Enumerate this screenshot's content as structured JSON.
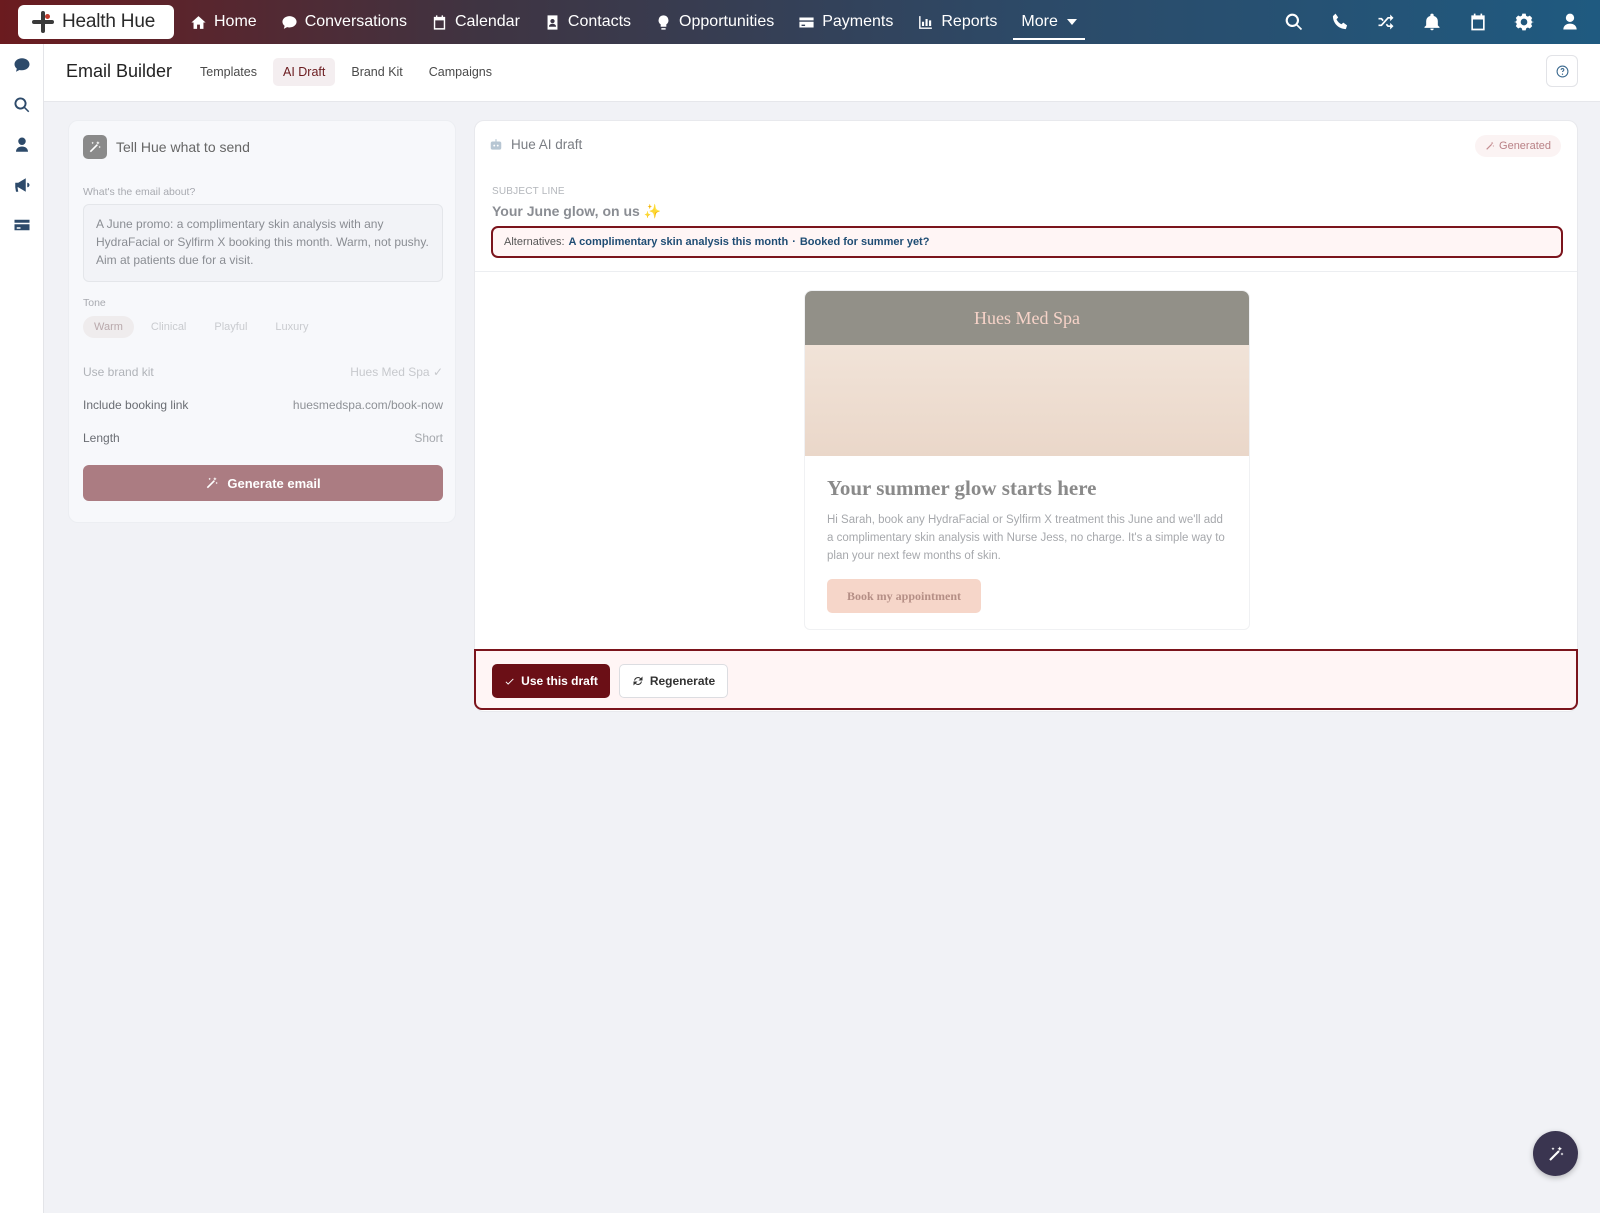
{
  "brand": {
    "name": "Health Hue",
    "logo_icon": "health-hue-logo"
  },
  "nav": {
    "items": [
      {
        "label": "Home",
        "icon": "home-icon"
      },
      {
        "label": "Conversations",
        "icon": "chat-icon"
      },
      {
        "label": "Calendar",
        "icon": "calendar-icon"
      },
      {
        "label": "Contacts",
        "icon": "contact-card-icon"
      },
      {
        "label": "Opportunities",
        "icon": "lightbulb-icon"
      },
      {
        "label": "Payments",
        "icon": "credit-card-icon"
      },
      {
        "label": "Reports",
        "icon": "bar-chart-icon"
      },
      {
        "label": "More",
        "icon": "chevron-down-icon"
      }
    ],
    "right_icons": [
      "search-icon",
      "phone-icon",
      "shuffle-icon",
      "bell-icon",
      "calendar-icon",
      "gear-icon",
      "user-icon"
    ]
  },
  "rail": {
    "icons": [
      "chat-icon",
      "search-icon",
      "user-icon",
      "megaphone-icon",
      "credit-card-icon"
    ]
  },
  "subheader": {
    "title": "Email Builder",
    "tabs": [
      "Templates",
      "AI Draft",
      "Brand Kit",
      "Campaigns"
    ],
    "active_tab": "AI Draft"
  },
  "left_panel": {
    "title": "Tell Hue what to send",
    "prompt_label": "What's the email about?",
    "prompt_text": "A June promo: a complimentary skin analysis with any HydraFacial or Sylfirm X booking this month. Warm, not pushy. Aim at patients due for a visit.",
    "tone_label": "Tone",
    "tones": [
      "Warm",
      "Clinical",
      "Playful",
      "Luxury"
    ],
    "active_tone": "Warm",
    "brand_kit_label": "Use brand kit",
    "brand_kit_value": "Hues Med Spa",
    "booking_label": "Include booking link",
    "booking_value": "huesmedspa.com/book-now",
    "length_label": "Length",
    "length_value": "Short",
    "generate_label": "Generate email"
  },
  "right_panel": {
    "title": "Hue AI draft",
    "badge": "Generated",
    "subject_label": "SUBJECT LINE",
    "subject_value": "Your June glow, on us",
    "subject_emoji": "✨",
    "alternatives_label": "Alternatives:",
    "alternative_1": "A complimentary skin analysis this month",
    "alternative_sep": "·",
    "alternative_2": "Booked for summer yet?"
  },
  "preview": {
    "brand_name": "Hues Med Spa",
    "headline": "Your summer glow starts here",
    "body": "Hi Sarah, book any HydraFacial or Sylfirm X treatment this June and we'll add a complimentary skin analysis with Nurse Jess, no charge. It's a simple way to plan your next few months of skin.",
    "cta": "Book my appointment"
  },
  "actions": {
    "use_label": "Use this draft",
    "regen_label": "Regenerate"
  },
  "colors": {
    "brand_maroon": "#6b0f16",
    "nav_start": "#6b1b1f",
    "nav_end": "#1f5a80",
    "accent_link": "#1f4d74"
  }
}
